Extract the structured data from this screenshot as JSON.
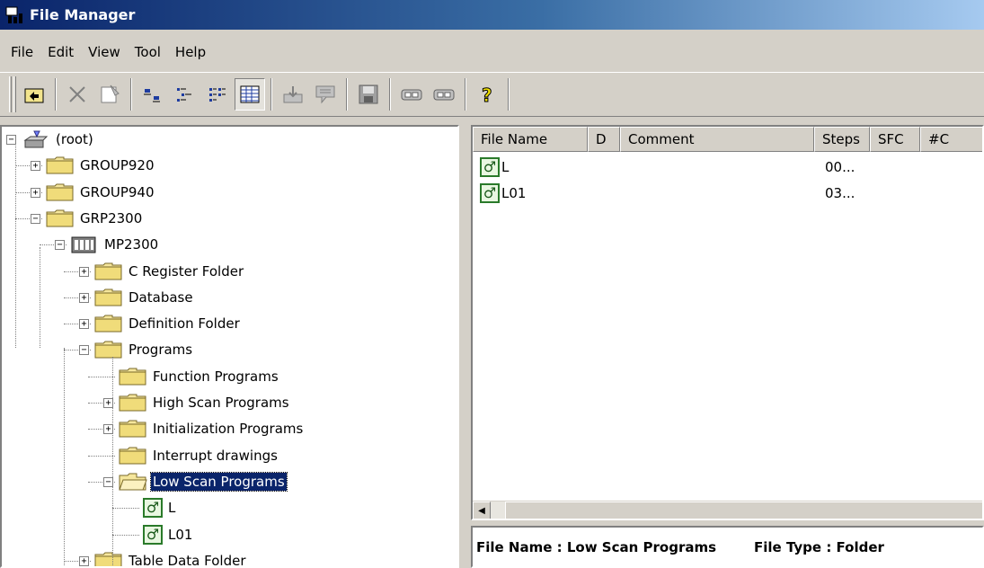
{
  "window": {
    "title": "File Manager"
  },
  "menu": [
    "File",
    "Edit",
    "View",
    "Tool",
    "Help"
  ],
  "toolbar": {
    "buttons": [
      "up-folder-icon",
      "delete-icon",
      "properties-icon",
      "large-icons-view-icon",
      "small-icons-view-icon",
      "list-view-icon",
      "details-view-icon",
      "import-icon",
      "export-icon",
      "save-icon",
      "connect-icon",
      "disconnect-icon",
      "help-icon"
    ]
  },
  "tree": [
    {
      "label": "(root)",
      "icon": "root-drive-icon",
      "level": 0,
      "expander": "minus"
    },
    {
      "label": "GROUP920",
      "icon": "folder-icon",
      "level": 1,
      "expander": "plus"
    },
    {
      "label": "GROUP940",
      "icon": "folder-icon",
      "level": 1,
      "expander": "plus"
    },
    {
      "label": "GRP2300",
      "icon": "folder-icon",
      "level": 1,
      "expander": "minus"
    },
    {
      "label": "MP2300",
      "icon": "controller-icon",
      "level": 2,
      "expander": "minus"
    },
    {
      "label": "C Register Folder",
      "icon": "folder-icon",
      "level": 3,
      "expander": "plus"
    },
    {
      "label": "Database",
      "icon": "folder-icon",
      "level": 3,
      "expander": "plus"
    },
    {
      "label": "Definition Folder",
      "icon": "folder-icon",
      "level": 3,
      "expander": "plus"
    },
    {
      "label": "Programs",
      "icon": "folder-icon",
      "level": 3,
      "expander": "minus"
    },
    {
      "label": "Function Programs",
      "icon": "folder-icon",
      "level": 4,
      "expander": "none"
    },
    {
      "label": "High Scan Programs",
      "icon": "folder-icon",
      "level": 4,
      "expander": "plus"
    },
    {
      "label": "Initialization Programs",
      "icon": "folder-icon",
      "level": 4,
      "expander": "plus"
    },
    {
      "label": "Interrupt drawings",
      "icon": "folder-icon",
      "level": 4,
      "expander": "none"
    },
    {
      "label": "Low Scan Programs",
      "icon": "open-folder-icon",
      "level": 4,
      "expander": "minus",
      "selected": true
    },
    {
      "label": "L",
      "icon": "program-icon",
      "level": 5,
      "expander": "none"
    },
    {
      "label": "L01",
      "icon": "program-icon",
      "level": 5,
      "expander": "none"
    },
    {
      "label": "Table Data Folder",
      "icon": "folder-icon",
      "level": 3,
      "expander": "plus"
    }
  ],
  "list": {
    "columns": [
      "File Name",
      "D",
      "Comment",
      "Steps",
      "SFC",
      "#C"
    ],
    "rows": [
      {
        "name": "L",
        "d": "",
        "comment": "",
        "steps": "00...",
        "sfc": "",
        "c": ""
      },
      {
        "name": "L01",
        "d": "",
        "comment": "",
        "steps": "03...",
        "sfc": "",
        "c": ""
      }
    ]
  },
  "status": {
    "file_name": "File Name : Low Scan Programs",
    "file_type": "File Type : Folder"
  }
}
